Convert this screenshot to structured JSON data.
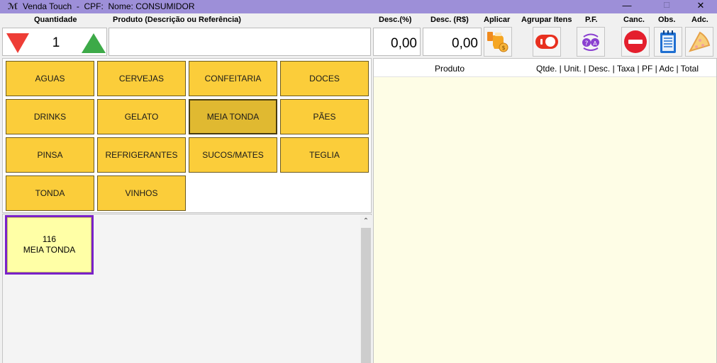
{
  "window": {
    "title": "Venda Touch  -  CPF:  Nome: CONSUMIDOR",
    "minimize": "—",
    "maximize": "☐",
    "close": "✕"
  },
  "headers": {
    "quantidade": "Quantidade",
    "produto": "Produto (Descrição ou Referência)",
    "desc_pct": "Desc.(%)",
    "desc_rs": "Desc. (R$)",
    "aplicar": "Aplicar",
    "agrupar": "Agrupar Itens",
    "pf": "P.F.",
    "canc": "Canc.",
    "obs": "Obs.",
    "adc": "Adc."
  },
  "quantity": "1",
  "product_input": {
    "value": "",
    "placeholder": ""
  },
  "discount": {
    "percent": "0,00",
    "value": "0,00"
  },
  "categories": [
    {
      "label": "AGUAS"
    },
    {
      "label": "CERVEJAS"
    },
    {
      "label": "CONFEITARIA"
    },
    {
      "label": "DOCES"
    },
    {
      "label": "DRINKS"
    },
    {
      "label": "GELATO"
    },
    {
      "label": "MEIA TONDA",
      "selected": true
    },
    {
      "label": "PÃES"
    },
    {
      "label": "PINSA"
    },
    {
      "label": "REFRIGERANTES"
    },
    {
      "label": "SUCOS/MATES"
    },
    {
      "label": "TEGLIA"
    },
    {
      "label": "TONDA"
    },
    {
      "label": "VINHOS"
    }
  ],
  "items": [
    {
      "code": "116",
      "name": "MEIA TONDA"
    }
  ],
  "cart": {
    "col_produto": "Produto",
    "col_rest": "Qtde. | Unit. | Desc. | Taxa | PF | Adc | Total"
  },
  "colors": {
    "titlebar": "#9d8fd8",
    "category": "#fbcd3a",
    "item_card": "#ffffa6",
    "item_border": "#7a22c8",
    "cart_bg": "#fefde6"
  },
  "icons": {
    "decrease": "red-down-triangle",
    "increase": "green-up-triangle",
    "aplicar": "hand-coin-icon",
    "agrupar": "toggle-switch-icon",
    "pf": "cycle-arrows-icon",
    "canc": "no-entry-icon",
    "obs": "notepad-icon",
    "adc": "pizza-slice-icon"
  }
}
